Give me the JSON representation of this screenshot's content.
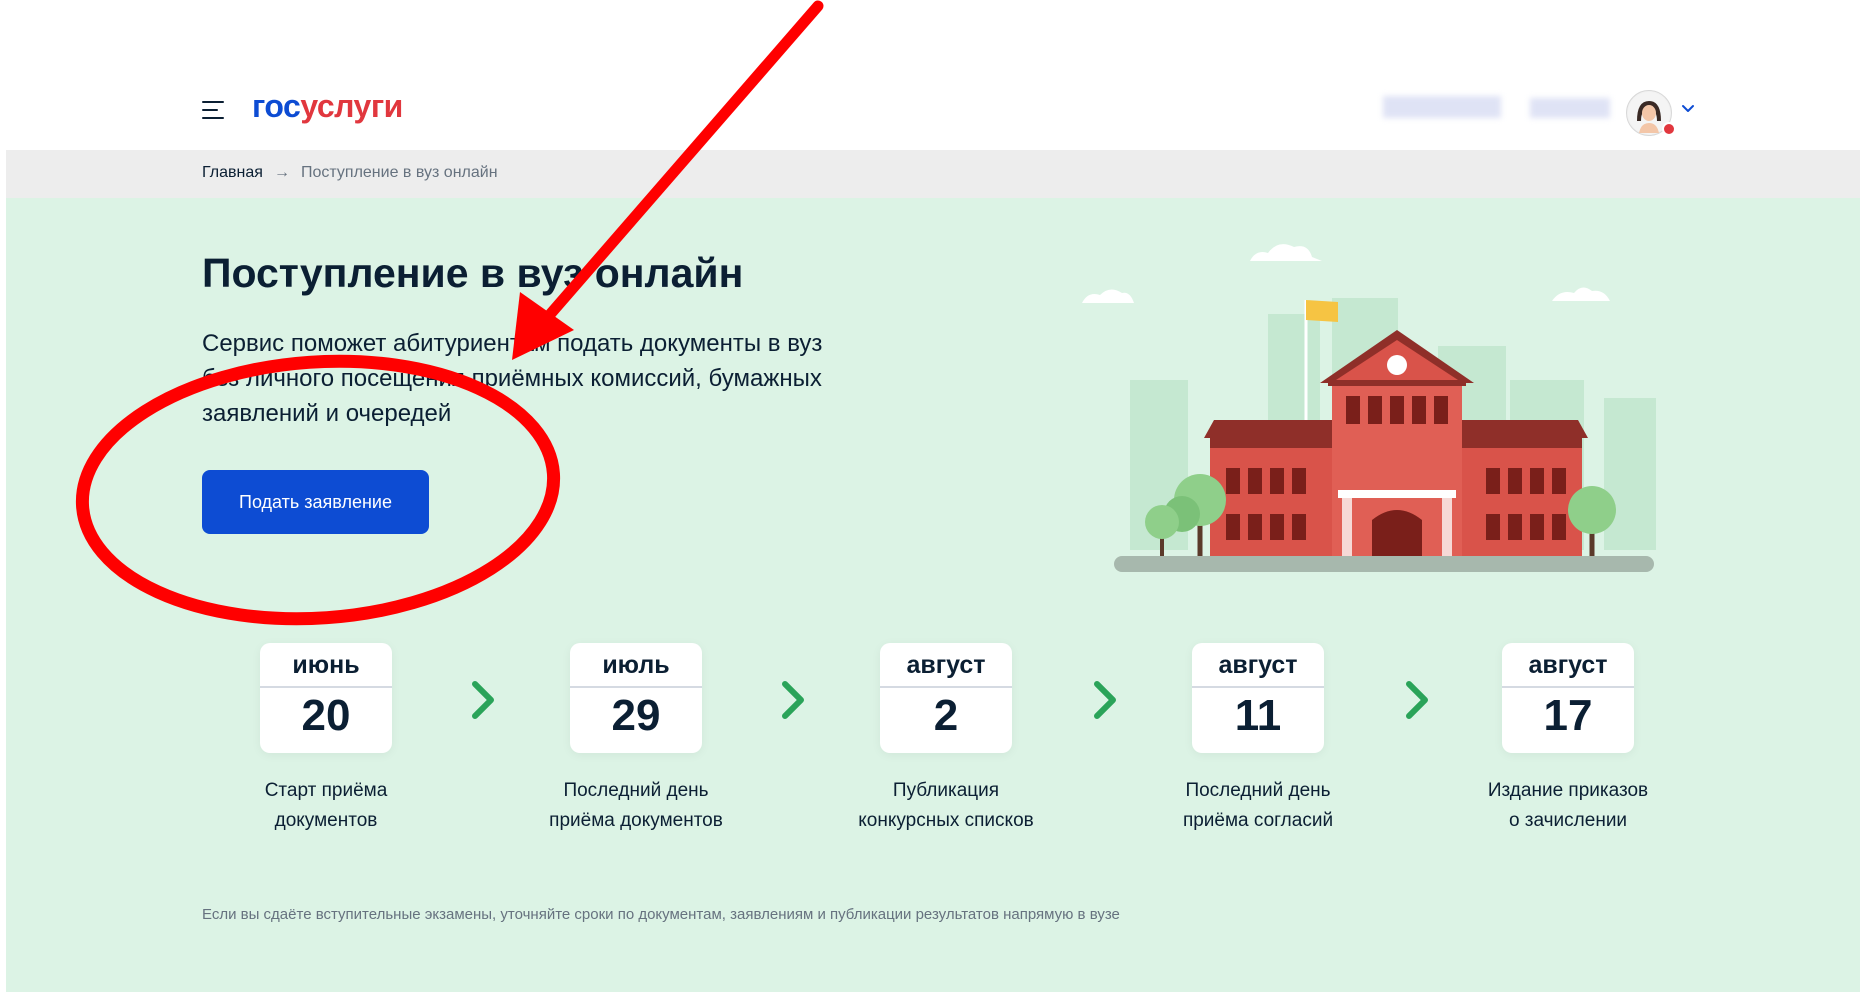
{
  "header": {
    "logo_part1": "гос",
    "logo_part2": "услуги",
    "menu_icon": "burger-menu-icon",
    "avatar_icon": "user-avatar-icon",
    "chevron_icon": "chevron-down-icon"
  },
  "breadcrumbs": {
    "home": "Главная",
    "separator": "→",
    "current": "Поступление в вуз онлайн"
  },
  "hero": {
    "title": "Поступление в вуз онлайн",
    "description": "Сервис поможет абитуриентам подать документы в вуз без личного посещения приёмных комиссий, бумажных заявлений и очередей",
    "button_label": "Подать заявление",
    "illustration": "university-building-illustration"
  },
  "timeline": [
    {
      "month": "июнь",
      "day": "20",
      "caption_line1": "Старт приёма",
      "caption_line2": "документов"
    },
    {
      "month": "июль",
      "day": "29",
      "caption_line1": "Последний день",
      "caption_line2": "приёма документов"
    },
    {
      "month": "август",
      "day": "2",
      "caption_line1": "Публикация",
      "caption_line2": "конкурсных списков"
    },
    {
      "month": "август",
      "day": "11",
      "caption_line1": "Последний день",
      "caption_line2": "приёма согласий"
    },
    {
      "month": "август",
      "day": "17",
      "caption_line1": "Издание приказов",
      "caption_line2": "о зачислении"
    }
  ],
  "note": "Если вы сдаёте вступительные экзамены, уточняйте сроки по документам, заявлениям и публикации результатов напрямую в вузе",
  "annotations": {
    "arrow_icon": "red-arrow-annotation",
    "ellipse_icon": "red-ellipse-annotation"
  },
  "colors": {
    "brand_blue": "#0d4cd3",
    "brand_red": "#e1373e",
    "hero_bg": "#dcf3e5",
    "chevron_green": "#2aa359",
    "annotation_red": "#ff0000"
  }
}
